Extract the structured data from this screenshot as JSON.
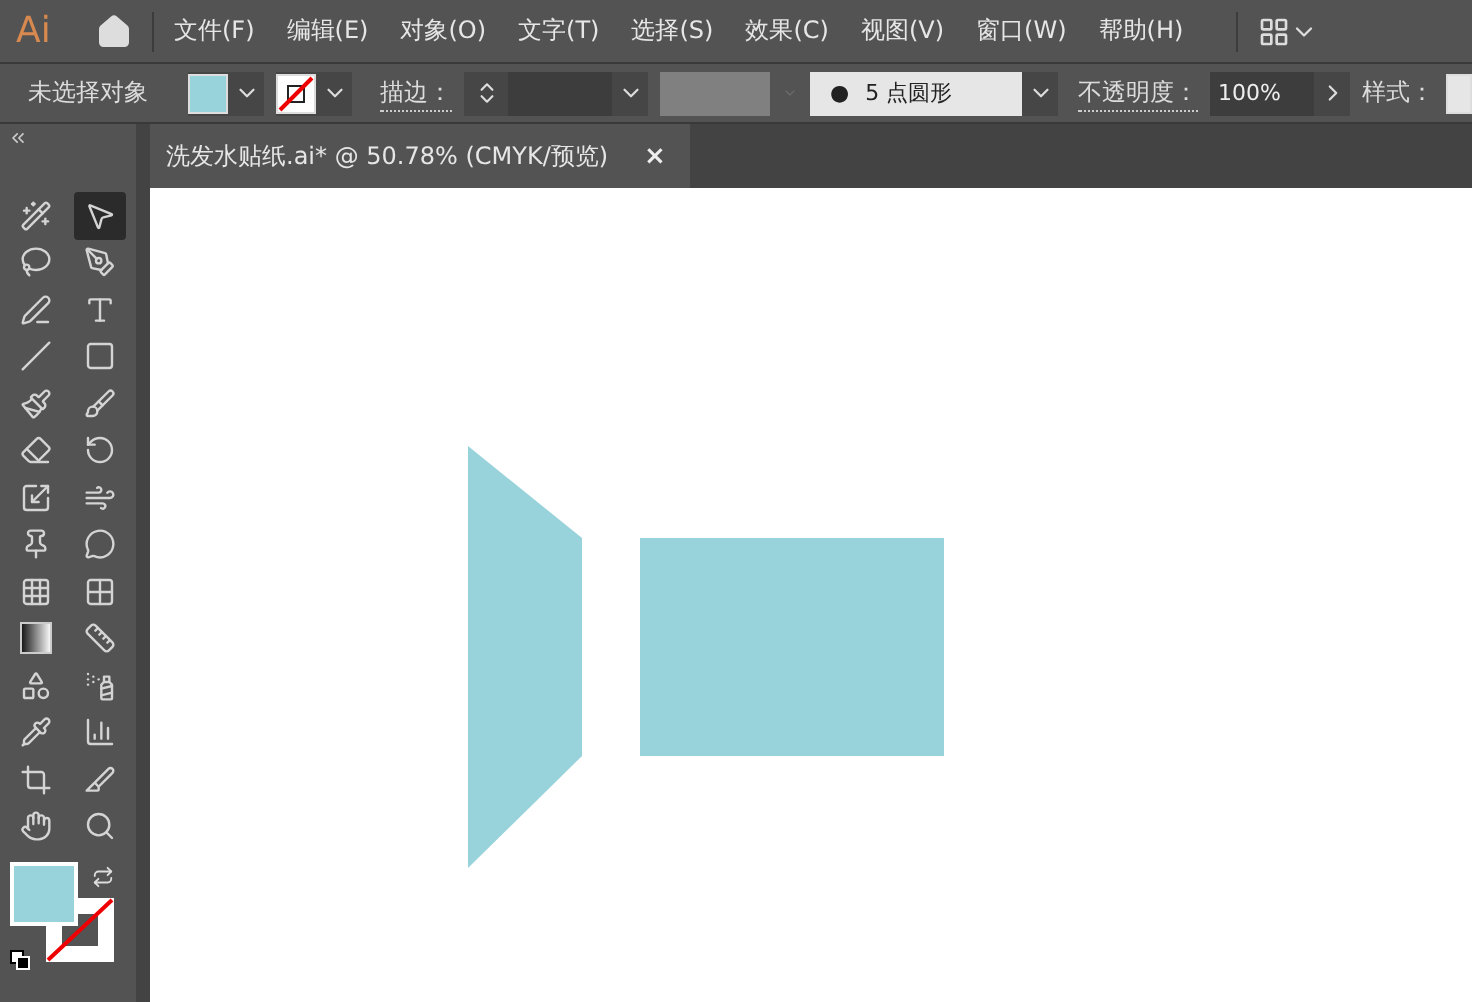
{
  "app": {
    "logo": "Ai"
  },
  "menu": [
    "文件(F)",
    "编辑(E)",
    "对象(O)",
    "文字(T)",
    "选择(S)",
    "效果(C)",
    "视图(V)",
    "窗口(W)",
    "帮助(H)"
  ],
  "control_bar": {
    "selection_label": "未选择对象",
    "stroke_label": "描边：",
    "brush": {
      "bullet": "●",
      "value": "5  点圆形"
    },
    "opacity_label": "不透明度：",
    "opacity_value": "100%",
    "style_label": "样式："
  },
  "document_tab": {
    "title": "洗发水贴纸.ai* @ 50.78% (CMYK/预览)",
    "close": "×"
  },
  "tools": [
    {
      "kind": "wand",
      "selected": false
    },
    {
      "kind": "select",
      "selected": true
    },
    {
      "kind": "lasso",
      "selected": false
    },
    {
      "kind": "pen",
      "selected": false
    },
    {
      "kind": "curvature",
      "selected": false
    },
    {
      "kind": "type",
      "selected": false
    },
    {
      "kind": "line",
      "selected": false
    },
    {
      "kind": "rect",
      "selected": false
    },
    {
      "kind": "brush",
      "selected": false
    },
    {
      "kind": "shaper",
      "selected": false
    },
    {
      "kind": "eraser",
      "selected": false
    },
    {
      "kind": "rotate",
      "selected": false
    },
    {
      "kind": "scale",
      "selected": false
    },
    {
      "kind": "warp",
      "selected": false
    },
    {
      "kind": "pin",
      "selected": false
    },
    {
      "kind": "bubble",
      "selected": false
    },
    {
      "kind": "grid",
      "selected": false
    },
    {
      "kind": "mesh",
      "selected": false
    },
    {
      "kind": "gradient",
      "selected": false
    },
    {
      "kind": "ruler",
      "selected": false
    },
    {
      "kind": "shapes",
      "selected": false
    },
    {
      "kind": "spray",
      "selected": false
    },
    {
      "kind": "dropper",
      "selected": false
    },
    {
      "kind": "chart",
      "selected": false
    },
    {
      "kind": "crop",
      "selected": false
    },
    {
      "kind": "slice",
      "selected": false
    },
    {
      "kind": "hand",
      "selected": false
    },
    {
      "kind": "zoom",
      "selected": false
    }
  ]
}
